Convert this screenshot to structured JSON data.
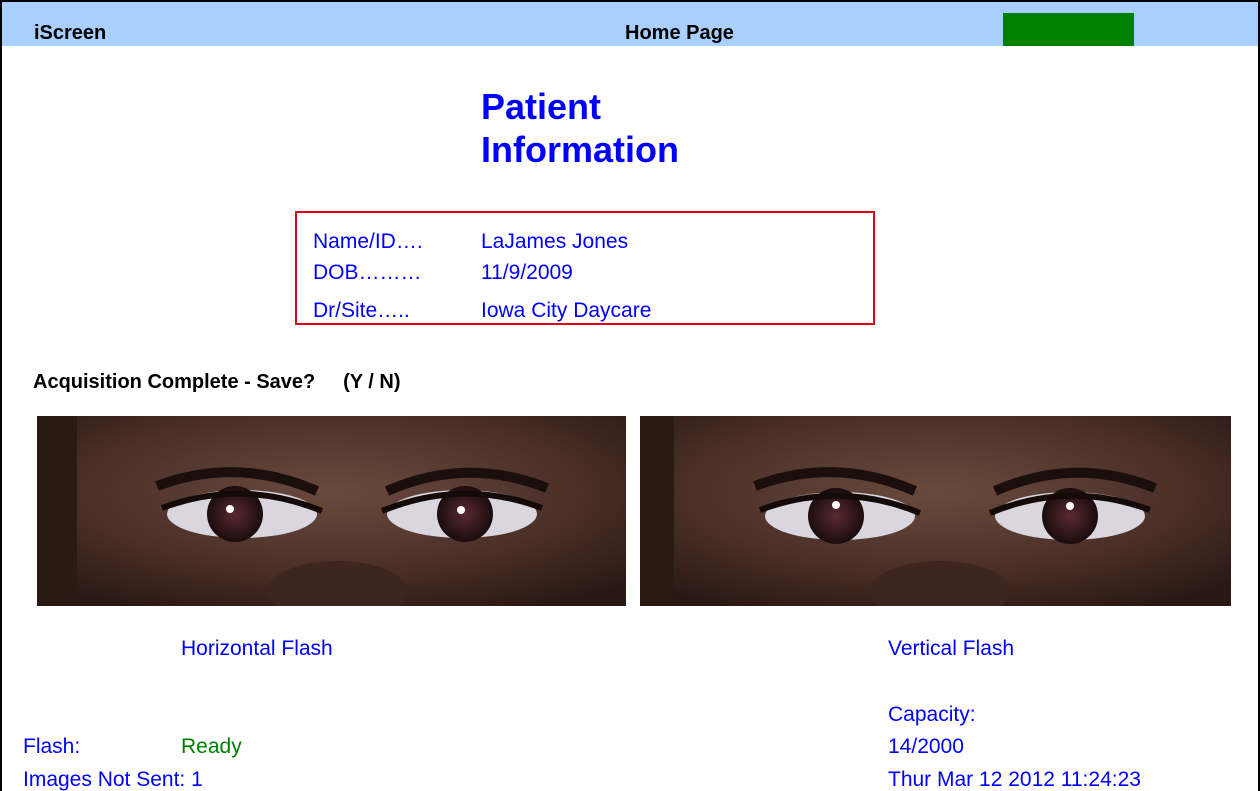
{
  "titlebar": {
    "app_name": "iScreen",
    "page_name": "Home Page",
    "indicator_color": "#008000",
    "background_color": "#a8cfff"
  },
  "heading": {
    "line1": "Patient",
    "line2": "Information"
  },
  "patient": {
    "name_label": "Name/ID….",
    "name_value": "LaJames Jones",
    "dob_label": "DOB………",
    "dob_value": "11/9/2009",
    "site_label": "Dr/Site…..",
    "site_value": "Iowa City Daycare"
  },
  "prompt": {
    "text": "Acquisition Complete - Save?",
    "options": "(Y / N)"
  },
  "images": {
    "left_caption": "Horizontal Flash",
    "right_caption": "Vertical Flash"
  },
  "status": {
    "flash_label": "Flash:",
    "flash_value": "Ready",
    "flash_color": "#008000",
    "images_not_sent": "Images Not Sent:  1",
    "capacity_label": "Capacity:",
    "capacity_value": "14/2000",
    "datetime": "Thur Mar 12 2012 11:24:23"
  }
}
